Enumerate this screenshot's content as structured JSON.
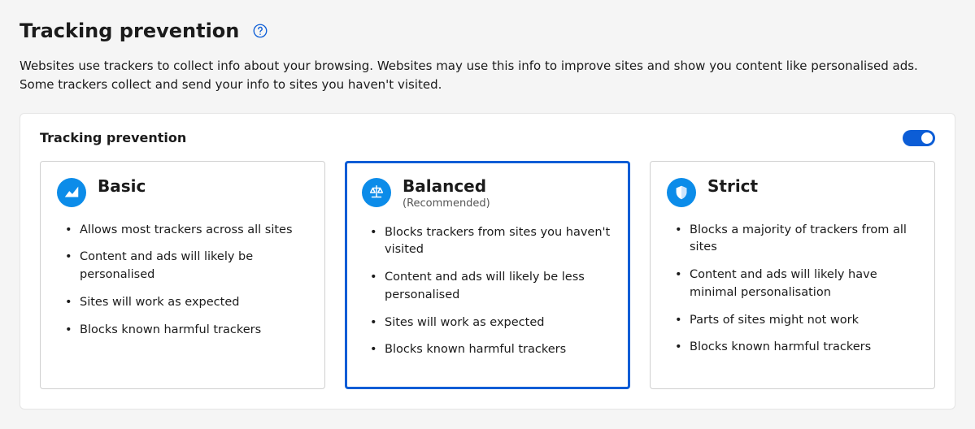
{
  "header": {
    "title": "Tracking prevention"
  },
  "description": "Websites use trackers to collect info about your browsing. Websites may use this info to improve sites and show you content like personalised ads. Some trackers collect and send your info to sites you haven't visited.",
  "card": {
    "title": "Tracking prevention",
    "toggle_on": true
  },
  "options": {
    "basic": {
      "title": "Basic",
      "bullets": [
        "Allows most trackers across all sites",
        "Content and ads will likely be personalised",
        "Sites will work as expected",
        "Blocks known harmful trackers"
      ]
    },
    "balanced": {
      "title": "Balanced",
      "subtitle": "(Recommended)",
      "bullets": [
        "Blocks trackers from sites you haven't visited",
        "Content and ads will likely be less personalised",
        "Sites will work as expected",
        "Blocks known harmful trackers"
      ]
    },
    "strict": {
      "title": "Strict",
      "bullets": [
        "Blocks a majority of trackers from all sites",
        "Content and ads will likely have minimal personalisation",
        "Parts of sites might not work",
        "Blocks known harmful trackers"
      ]
    }
  }
}
